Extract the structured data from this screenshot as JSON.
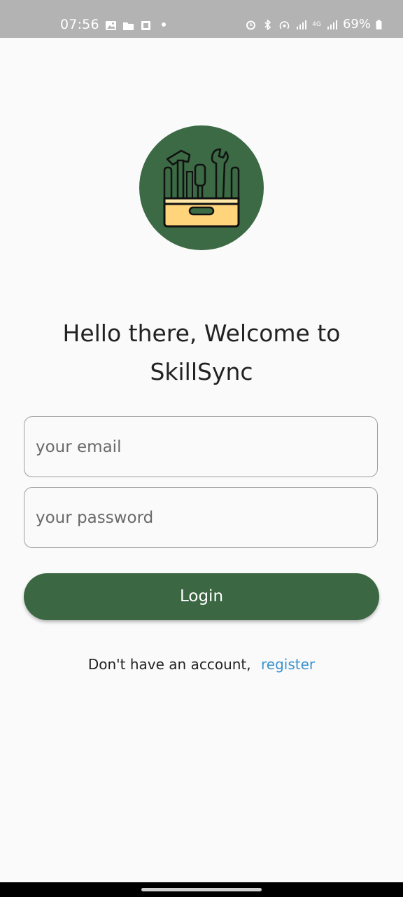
{
  "status_bar": {
    "time": "07:56",
    "battery": "69%",
    "network": "4G"
  },
  "app": {
    "logo_icon": "toolbox-icon",
    "welcome_text": "Hello there, Welcome to SkillSync"
  },
  "form": {
    "email_placeholder": "your email",
    "password_placeholder": "your password",
    "login_label": "Login"
  },
  "footer": {
    "prompt": "Don't have an account,",
    "register_label": "register"
  },
  "colors": {
    "primary": "#3b6742",
    "link": "#3a93d0",
    "background": "#fafafa"
  }
}
